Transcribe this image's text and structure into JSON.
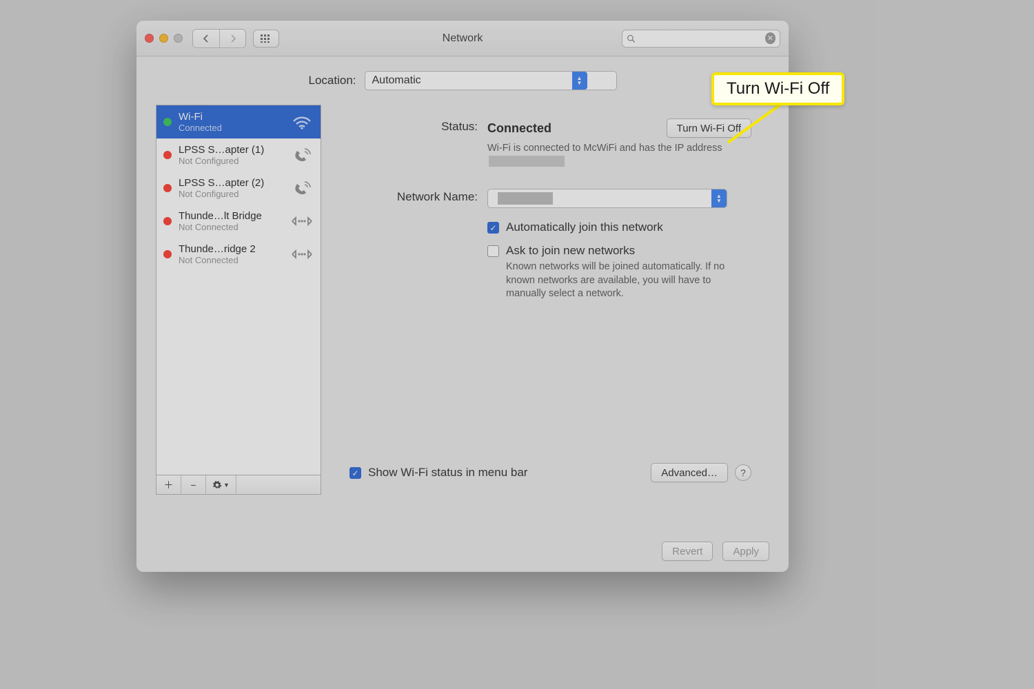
{
  "window": {
    "title": "Network"
  },
  "search": {
    "placeholder": ""
  },
  "location": {
    "label": "Location:",
    "value": "Automatic"
  },
  "sidebar": {
    "items": [
      {
        "name": "Wi-Fi",
        "sub": "Connected",
        "status": "green",
        "icon": "wifi",
        "selected": true
      },
      {
        "name": "LPSS S…apter (1)",
        "sub": "Not Configured",
        "status": "red",
        "icon": "phone"
      },
      {
        "name": "LPSS S…apter (2)",
        "sub": "Not Configured",
        "status": "red",
        "icon": "phone"
      },
      {
        "name": "Thunde…lt Bridge",
        "sub": "Not Connected",
        "status": "red",
        "icon": "bridge"
      },
      {
        "name": "Thunde…ridge 2",
        "sub": "Not Connected",
        "status": "red",
        "icon": "bridge"
      }
    ]
  },
  "detail": {
    "status_label": "Status:",
    "status_value": "Connected",
    "toggle_label": "Turn Wi-Fi Off",
    "status_desc_prefix": "Wi-Fi is connected to McWiFi and has the IP address ",
    "network_name_label": "Network Name:",
    "auto_join": "Automatically join this network",
    "ask_join": "Ask to join new networks",
    "ask_desc": "Known networks will be joined automatically. If no known networks are available, you will have to manually select a network.",
    "show_status": "Show Wi-Fi status in menu bar",
    "advanced": "Advanced…"
  },
  "footer": {
    "revert": "Revert",
    "apply": "Apply"
  },
  "callout": {
    "text": "Turn Wi-Fi Off"
  }
}
